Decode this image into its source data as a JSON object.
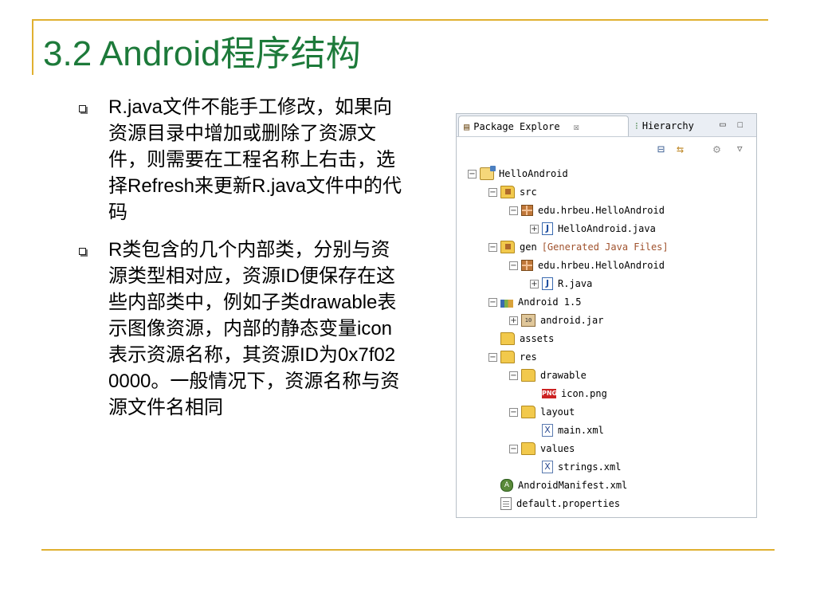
{
  "slide": {
    "title": "3.2  Android程序结构",
    "bullets": [
      "R.java文件不能手工修改，如果向资源目录中增加或删除了资源文件，则需要在工程名称上右击，选择Refresh来更新R.java文件中的代码",
      "R类包含的几个内部类，分别与资源类型相对应，资源ID便保存在这些内部类中，例如子类drawable表示图像资源，内部的静态变量icon表示资源名称，其资源ID为0x7f020000。一般情况下，资源名称与资源文件名相同"
    ]
  },
  "explorer": {
    "tabs": {
      "package_explorer": "Package Explore",
      "close": "☒",
      "hierarchy": "Hierarchy"
    },
    "window_buttons": {
      "minimize": "▭",
      "maximize": "☐"
    },
    "tree": [
      {
        "label": "HelloAndroid",
        "icon": "project-icon",
        "toggle": "−"
      },
      {
        "label": "src",
        "icon": "source-folder-icon",
        "toggle": "−"
      },
      {
        "label": "edu.hrbeu.HelloAndroid",
        "icon": "package-icon",
        "toggle": "−"
      },
      {
        "label": "HelloAndroid.java",
        "icon": "java-file-icon",
        "toggle": "+"
      },
      {
        "label": "gen",
        "decoration": "[Generated Java Files]",
        "icon": "source-folder-icon",
        "toggle": "−"
      },
      {
        "label": "edu.hrbeu.HelloAndroid",
        "icon": "package-icon",
        "toggle": "−"
      },
      {
        "label": "R.java",
        "icon": "java-file-icon",
        "toggle": "+"
      },
      {
        "label": "Android 1.5",
        "icon": "library-icon",
        "toggle": "−"
      },
      {
        "label": "android.jar",
        "icon": "jar-icon",
        "toggle": "+"
      },
      {
        "label": "assets",
        "icon": "folder-icon",
        "toggle": ""
      },
      {
        "label": "res",
        "icon": "folder-icon",
        "toggle": "−"
      },
      {
        "label": "drawable",
        "icon": "folder-icon",
        "toggle": "−"
      },
      {
        "label": "icon.png",
        "icon": "png-file-icon",
        "toggle": ""
      },
      {
        "label": "layout",
        "icon": "folder-icon",
        "toggle": "−"
      },
      {
        "label": "main.xml",
        "icon": "xml-file-icon",
        "toggle": ""
      },
      {
        "label": "values",
        "icon": "folder-icon",
        "toggle": "−"
      },
      {
        "label": "strings.xml",
        "icon": "xml-file-icon",
        "toggle": ""
      },
      {
        "label": "AndroidManifest.xml",
        "icon": "manifest-icon",
        "toggle": ""
      },
      {
        "label": "default.properties",
        "icon": "file-icon",
        "toggle": ""
      }
    ]
  }
}
